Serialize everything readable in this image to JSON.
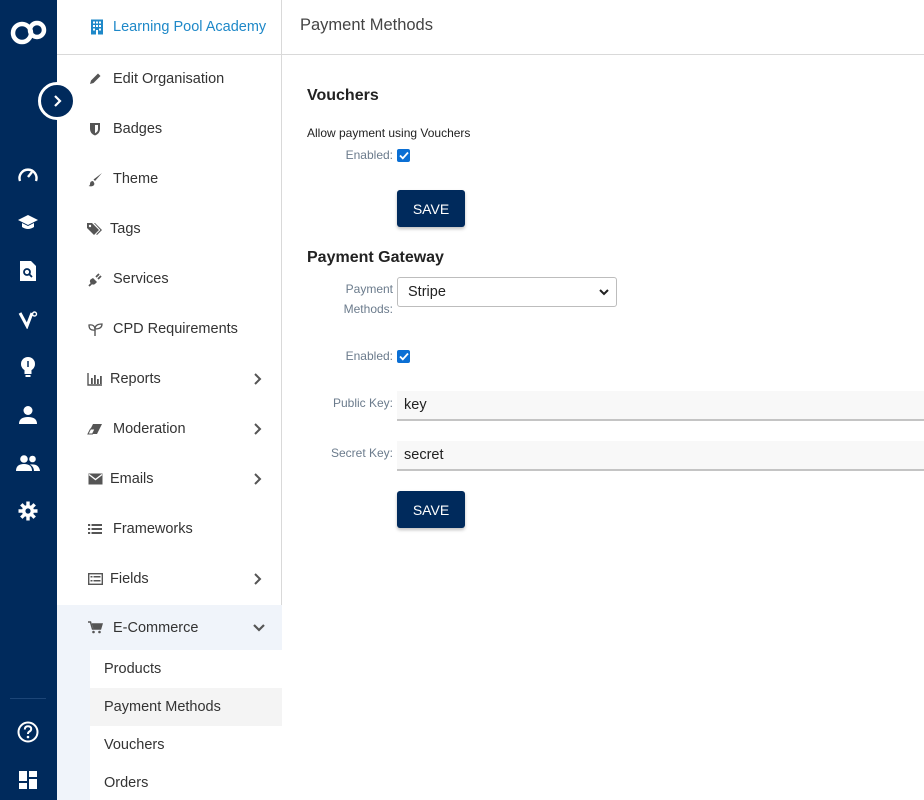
{
  "organisation": {
    "name": "Learning Pool Academy"
  },
  "header": {
    "title": "Payment Methods"
  },
  "sidebar": {
    "items": [
      {
        "label": "Edit Organisation"
      },
      {
        "label": "Badges"
      },
      {
        "label": "Theme"
      },
      {
        "label": "Tags"
      },
      {
        "label": "Services"
      },
      {
        "label": "CPD Requirements"
      },
      {
        "label": "Reports"
      },
      {
        "label": "Moderation"
      },
      {
        "label": "Emails"
      },
      {
        "label": "Frameworks"
      },
      {
        "label": "Fields"
      },
      {
        "label": "E-Commerce"
      }
    ],
    "ecommerce_sub": [
      {
        "label": "Products"
      },
      {
        "label": "Payment Methods"
      },
      {
        "label": "Vouchers"
      },
      {
        "label": "Orders"
      }
    ]
  },
  "vouchers": {
    "title": "Vouchers",
    "allow_text": "Allow payment using Vouchers",
    "enabled_label": "Enabled:",
    "enabled": true,
    "save_label": "SAVE"
  },
  "gateway": {
    "title": "Payment Gateway",
    "methods_label_1": "Payment",
    "methods_label_2": "Methods:",
    "method_value": "Stripe",
    "enabled_label": "Enabled:",
    "enabled": true,
    "public_key_label": "Public Key:",
    "public_key_value": "key",
    "secret_key_label": "Secret Key:",
    "secret_key_value": "secret",
    "save_label": "SAVE"
  },
  "colors": {
    "brand_navy": "#002a5c",
    "link_blue": "#1e88c8",
    "checkbox_blue": "#0b6fd4"
  }
}
